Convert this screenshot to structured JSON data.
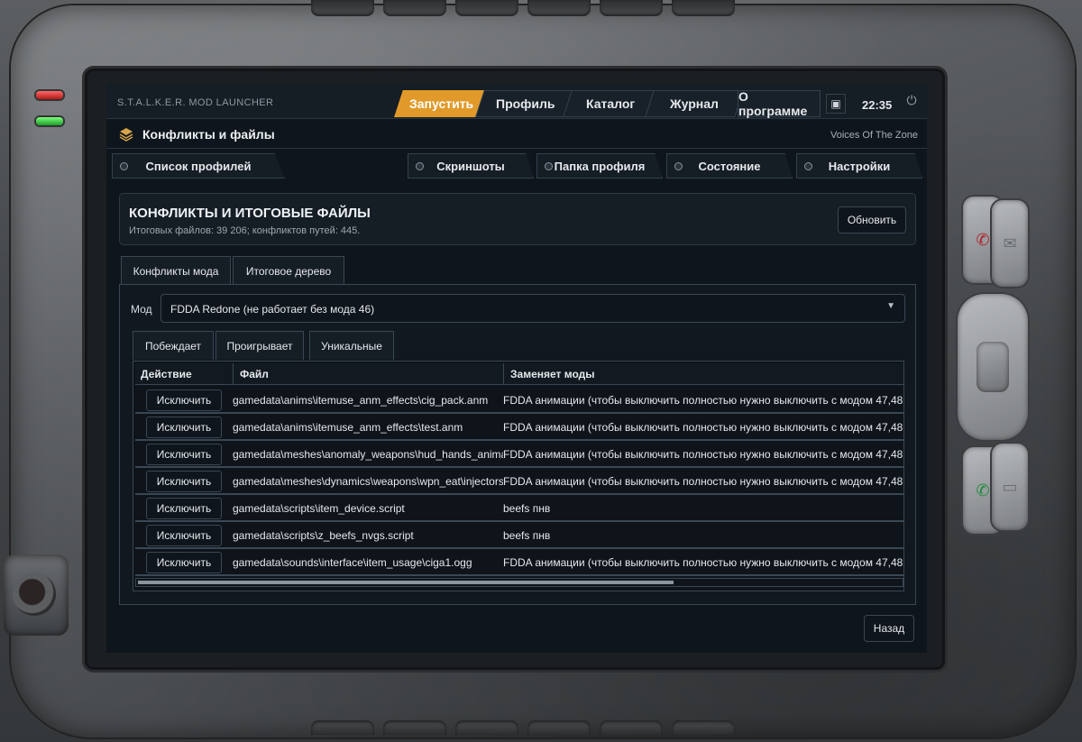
{
  "app": {
    "title": "S.T.A.L.K.E.R. MOD LAUNCHER",
    "clock": "22:35"
  },
  "nav": {
    "launch": "Запустить",
    "profile": "Профиль",
    "catalog": "Каталог",
    "journal": "Журнал",
    "about": "О программе"
  },
  "page": {
    "title": "Конфликты и файлы",
    "profile_name": "Voices Of The Zone"
  },
  "subnav": {
    "profiles": "Список профилей",
    "screenshots": "Скриншоты",
    "folder": "Папка профиля",
    "state": "Состояние",
    "settings": "Настройки"
  },
  "panel": {
    "title": "КОНФЛИКТЫ И ИТОГОВЫЕ ФАЙЛЫ",
    "subtitle": "Итоговых файлов: 39 206; конфликтов путей: 445.",
    "refresh": "Обновить"
  },
  "tabs": {
    "conflicts": "Конфликты мода",
    "tree": "Итоговое дерево"
  },
  "mod": {
    "label": "Мод",
    "selected": "FDDA Redone (не работает без мода 46)"
  },
  "inner_tabs": {
    "wins": "Побеждает",
    "loses": "Проигрывает",
    "unique": "Уникальные"
  },
  "grid": {
    "headers": {
      "action": "Действие",
      "file": "Файл",
      "replaces": "Заменяет моды"
    },
    "rows": [
      {
        "action": "Исключить",
        "file": "gamedata\\anims\\itemuse_anm_effects\\cig_pack.anm",
        "replaces": "FDDA анимации (чтобы выключить полностью нужно выключить с модом 47,48"
      },
      {
        "action": "Исключить",
        "file": "gamedata\\anims\\itemuse_anm_effects\\test.anm",
        "replaces": "FDDA анимации (чтобы выключить полностью нужно выключить с модом 47,48"
      },
      {
        "action": "Исключить",
        "file": "gamedata\\meshes\\anomaly_weapons\\hud_hands_anima",
        "replaces": "FDDA анимации (чтобы выключить полностью нужно выключить с модом 47,48"
      },
      {
        "action": "Исключить",
        "file": "gamedata\\meshes\\dynamics\\weapons\\wpn_eat\\injectors",
        "replaces": "FDDA анимации (чтобы выключить полностью нужно выключить с модом 47,48"
      },
      {
        "action": "Исключить",
        "file": "gamedata\\scripts\\item_device.script",
        "replaces": "beefs пнв"
      },
      {
        "action": "Исключить",
        "file": "gamedata\\scripts\\z_beefs_nvgs.script",
        "replaces": "beefs пнв"
      },
      {
        "action": "Исключить",
        "file": "gamedata\\sounds\\interface\\item_usage\\ciga1.ogg",
        "replaces": "FDDA анимации (чтобы выключить полностью нужно выключить с модом 47,48"
      }
    ]
  },
  "footer": {
    "back": "Назад"
  },
  "colors": {
    "accent": "#e19a2a",
    "screen_bg": "#0f151c",
    "border": "#3a4754"
  },
  "icons": {
    "page": "layers-icon",
    "monitor": "monitor-icon",
    "power": "power-icon",
    "dropdown": "chevron-down-icon",
    "call": "phone-icon",
    "hangup": "phone-end-icon",
    "mail": "mail-icon",
    "doc": "document-icon"
  }
}
